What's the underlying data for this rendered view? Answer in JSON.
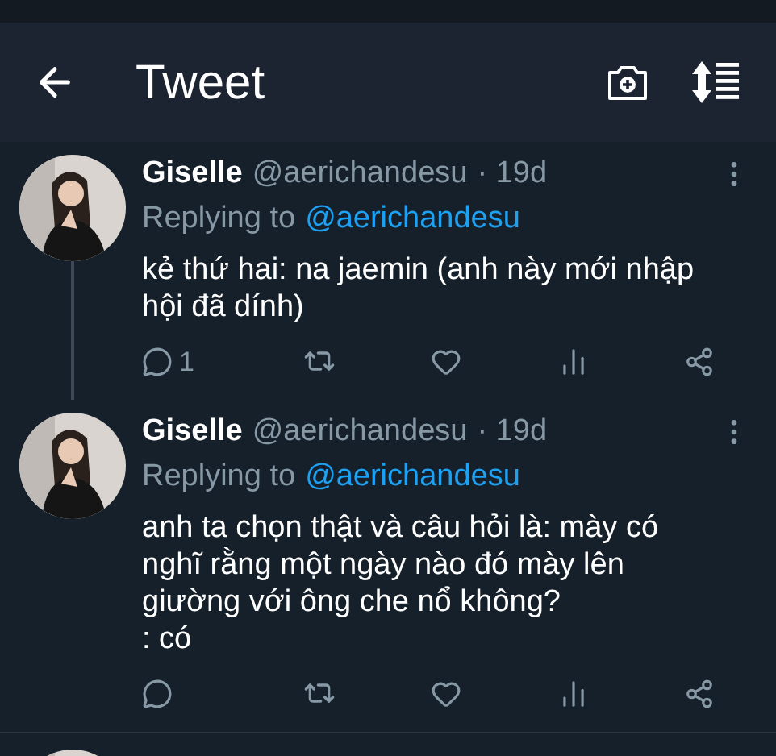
{
  "header": {
    "title": "Tweet"
  },
  "tweets": [
    {
      "name": "Giselle",
      "handle": "@aerichandesu",
      "time": "· 19d",
      "replying_label": "Replying to",
      "replying_to": "@aerichandesu",
      "text": "kẻ thứ hai: na jaemin (anh này mới nhập hội đã dính)",
      "reply_count": "1",
      "thread_line": true
    },
    {
      "name": "Giselle",
      "handle": "@aerichandesu",
      "time": "· 19d",
      "replying_label": "Replying to",
      "replying_to": "@aerichandesu",
      "text": "anh ta chọn thật và câu hỏi là: mày có nghĩ rằng một ngày nào đó mày lên giường với ông che nổ không?\n: có",
      "thread_line": false
    }
  ]
}
